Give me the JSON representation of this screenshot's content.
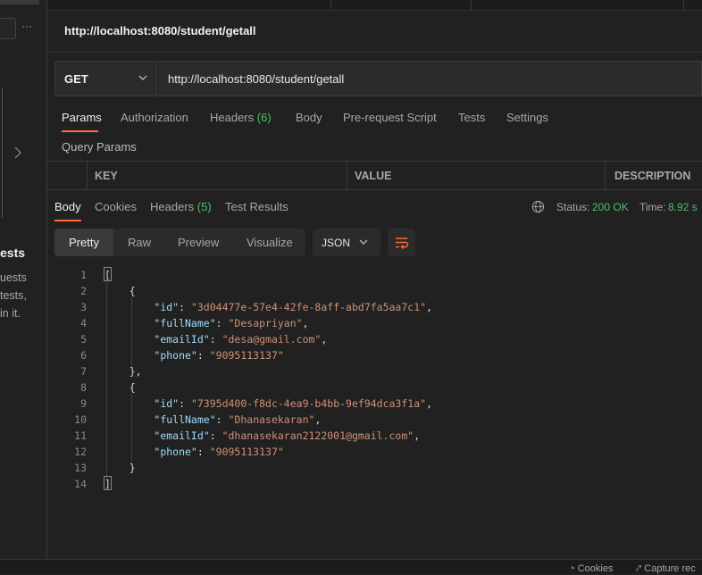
{
  "sidebar": {
    "more_icon": "···",
    "title": "ests",
    "lines": [
      "uests",
      "tests,",
      "in it."
    ]
  },
  "request": {
    "title": "http://localhost:8080/student/getall",
    "method": "GET",
    "url": "http://localhost:8080/student/getall",
    "tabs": [
      {
        "label": "Params"
      },
      {
        "label": "Authorization"
      },
      {
        "label": "Headers",
        "count": "(6)"
      },
      {
        "label": "Body"
      },
      {
        "label": "Pre-request Script"
      },
      {
        "label": "Tests"
      },
      {
        "label": "Settings"
      }
    ],
    "query_params_label": "Query Params",
    "table_headers": [
      "KEY",
      "VALUE",
      "DESCRIPTION"
    ]
  },
  "response": {
    "tabs": [
      {
        "label": "Body"
      },
      {
        "label": "Cookies"
      },
      {
        "label": "Headers",
        "count": "(5)"
      },
      {
        "label": "Test Results"
      }
    ],
    "status_label": "Status:",
    "status_value": "200 OK",
    "time_label": "Time:",
    "time_value": "8.92 s",
    "view_modes": [
      "Pretty",
      "Raw",
      "Preview",
      "Visualize"
    ],
    "format": "JSON",
    "line_numbers": [
      "1",
      "2",
      "3",
      "4",
      "5",
      "6",
      "7",
      "8",
      "9",
      "10",
      "11",
      "12",
      "13",
      "14"
    ],
    "records": [
      {
        "id": "\"3d04477e-57e4-42fe-8aff-abd7fa5aa7c1\"",
        "fullName": "\"Desapriyan\"",
        "emailId": "\"desa@gmail.com\"",
        "phone": "\"9095113137\""
      },
      {
        "id": "\"7395d400-f8dc-4ea9-b4bb-9ef94dca3f1a\"",
        "fullName": "\"Dhanasekaran\"",
        "emailId": "\"dhanasekaran2122001@gmail.com\"",
        "phone": "\"9095113137\""
      }
    ],
    "keys": {
      "id": "\"id\"",
      "fullName": "\"fullName\"",
      "emailId": "\"emailId\"",
      "phone": "\"phone\""
    }
  },
  "footer": {
    "cookies": "Cookies",
    "capture": "Capture rec"
  },
  "colors": {
    "accent": "#ff6c37",
    "success": "#4fbf6b",
    "json_key": "#9cdcfe",
    "json_string": "#ce9178"
  }
}
